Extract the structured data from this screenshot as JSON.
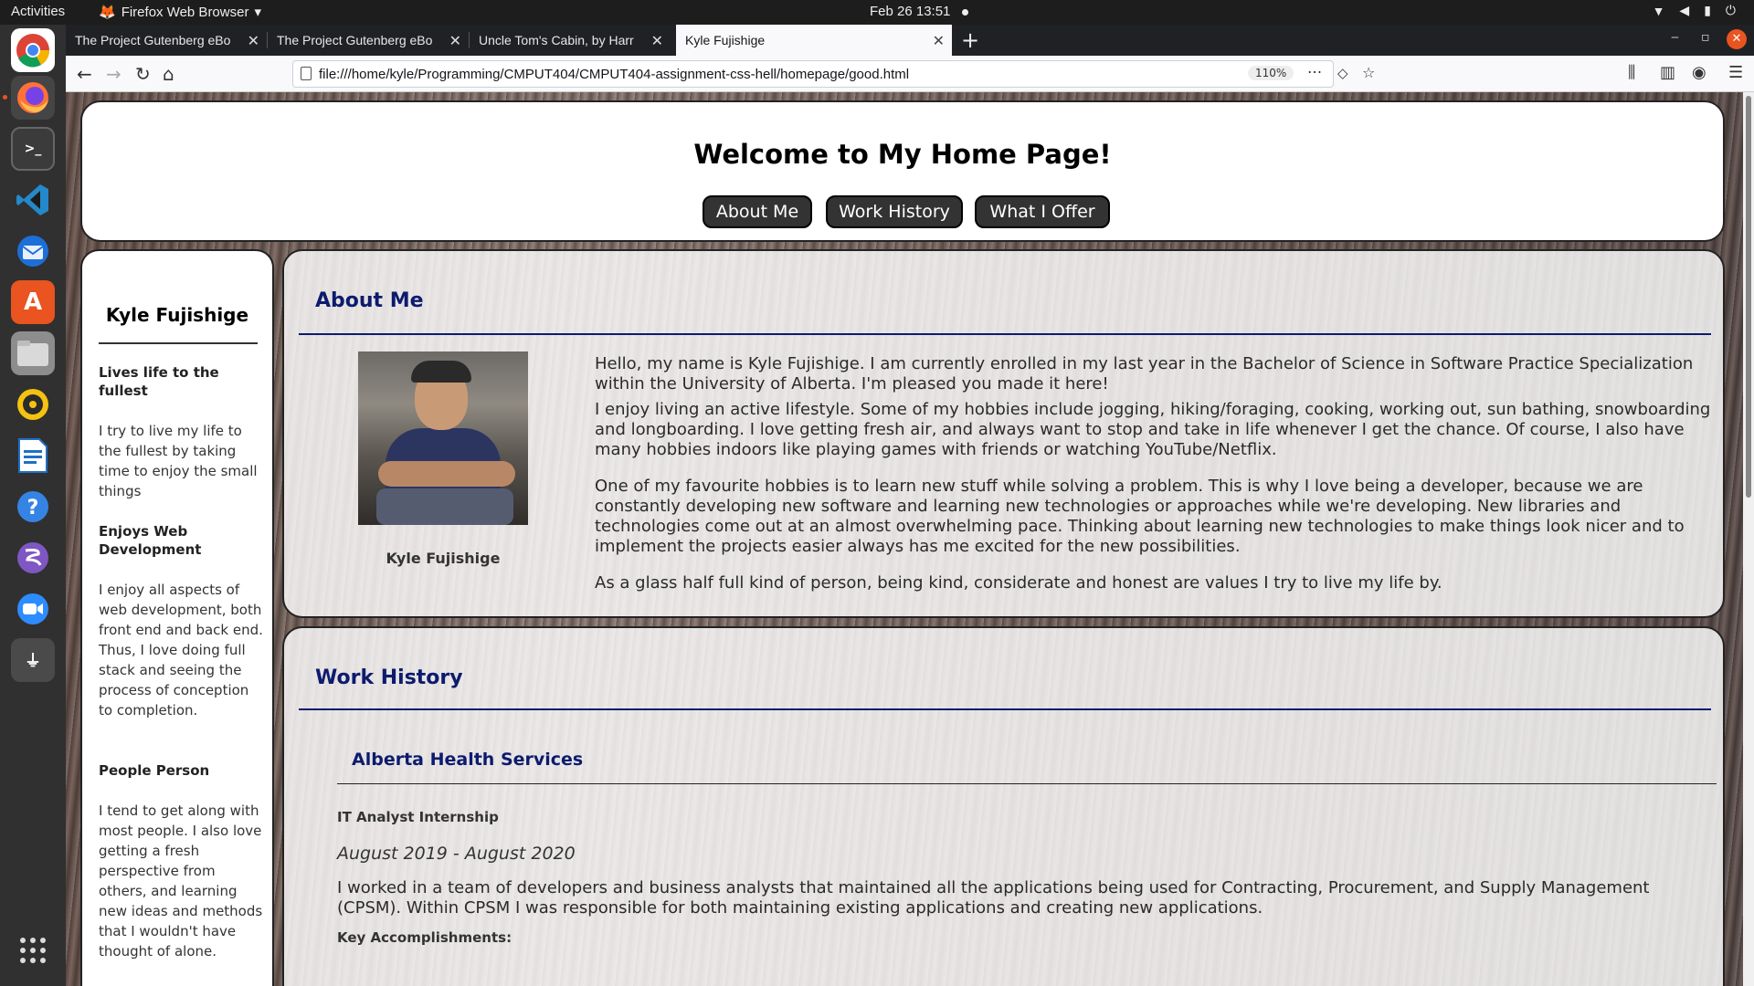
{
  "topbar": {
    "activities": "Activities",
    "app_name": "Firefox Web Browser",
    "clock": "Feb 26  13:51"
  },
  "dock": {
    "items": [
      "chrome",
      "firefox",
      "terminal",
      "vscode",
      "thunderbird",
      "software",
      "files",
      "rhythmbox",
      "writer",
      "help",
      "emacs",
      "zoom",
      "usb",
      "apps-grid"
    ]
  },
  "browser": {
    "tabs": [
      {
        "title": "The Project Gutenberg eBoo"
      },
      {
        "title": "The Project Gutenberg eBoo"
      },
      {
        "title": "Uncle Tom's Cabin, by Harrie"
      },
      {
        "title": "Kyle Fujishige",
        "active": true
      }
    ],
    "url": "file:///home/kyle/Programming/CMPUT404/CMPUT404-assignment-css-hell/homepage/good.html",
    "zoom": "110%"
  },
  "page": {
    "title": "Welcome to My Home Page!",
    "nav": [
      "About Me",
      "Work History",
      "What I Offer"
    ],
    "sidebar": {
      "name": "Kyle Fujishige",
      "sections": [
        {
          "heading": "Lives life to the fullest",
          "text": "I try to live my life to the fullest by taking time to enjoy the small things"
        },
        {
          "heading": "Enjoys Web Development",
          "text": "I enjoy all aspects of web development, both front end and back end. Thus, I love doing full stack and seeing the process of conception to completion."
        },
        {
          "heading": "People Person",
          "text": "I tend to get along with most people. I also love getting a fresh perspective from others, and learning new ideas and methods that I wouldn't have thought of alone."
        }
      ]
    },
    "about": {
      "heading": "About Me",
      "photo_caption": "Kyle Fujishige",
      "paragraphs": [
        "Hello, my name is Kyle Fujishige. I am currently enrolled in my last year in the Bachelor of Science in Software Practice Specialization within the University of Alberta. I'm pleased you made it here!",
        "I enjoy living an active lifestyle. Some of my hobbies include jogging, hiking/foraging, cooking, working out, sun bathing, snowboarding and longboarding. I love getting fresh air, and always want to stop and take in life whenever I get the chance. Of course, I also have many hobbies indoors like playing games with friends or watching YouTube/Netflix.",
        "One of my favourite hobbies is to learn new stuff while solving a problem. This is why I love being a developer, because we are constantly developing new software and learning new technologies or approaches while we're developing. New libraries and technologies come out at an almost overwhelming pace. Thinking about learning new technologies to make things look nicer and to implement the projects easier always has me excited for the new possibilities.",
        "As a glass half full kind of person, being kind, considerate and honest are values I try to live my life by."
      ]
    },
    "work": {
      "heading": "Work History",
      "company": "Alberta Health Services",
      "title": "IT Analyst Internship",
      "dates": "August 2019 - August 2020",
      "description": "I worked in a team of developers and business analysts that maintained all the applications being used for Contracting, Procurement, and Supply Management (CPSM). Within CPSM I was responsible for both maintaining existing applications and creating new applications.",
      "key_label": "Key Accomplishments:"
    }
  }
}
